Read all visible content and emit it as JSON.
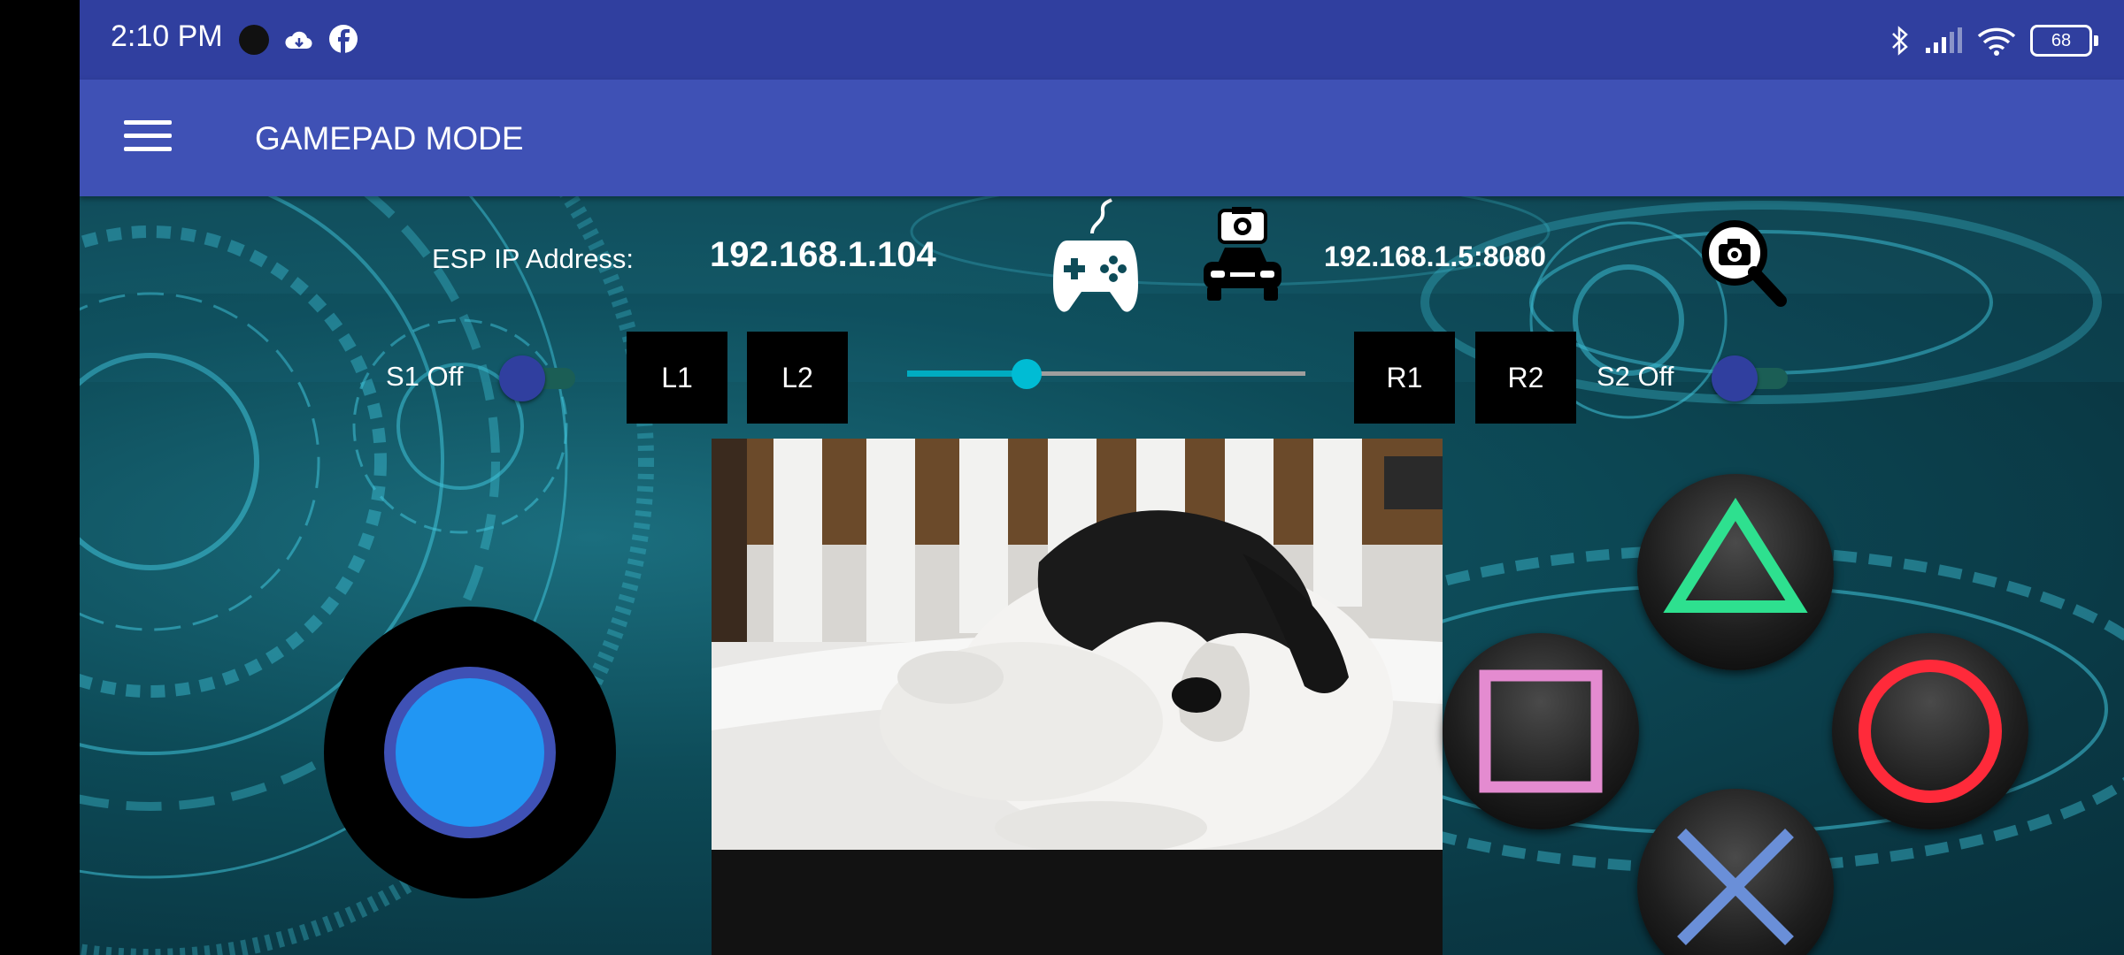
{
  "status_bar": {
    "time": "2:10 PM",
    "icons": [
      "dot-icon",
      "cloud-icon",
      "facebook-icon",
      "bluetooth-icon",
      "signal-icon",
      "wifi-icon"
    ],
    "battery": "68"
  },
  "toolbar": {
    "title": "GAMEPAD MODE",
    "menu_icon": "hamburger-icon"
  },
  "connection": {
    "esp_label": "ESP IP Address:",
    "esp_value": "192.168.1.104",
    "camera_address": "192.168.1.5:8080",
    "icons": [
      "gamepad-icon",
      "car-camera-icon",
      "camera-search-icon"
    ]
  },
  "controls": {
    "s1_label": "S1 Off",
    "s2_label": "S2 Off",
    "s1_on": false,
    "s2_on": false,
    "l1": "L1",
    "l2": "L2",
    "r1": "R1",
    "r2": "R2",
    "slider_value_fraction": 0.3
  },
  "face_buttons": [
    "triangle",
    "square",
    "circle",
    "cross"
  ],
  "colors": {
    "status_bar": "#303f9f",
    "toolbar": "#3f51b5",
    "accent": "#00bcd4",
    "joystick_stick": "#2196f3",
    "triangle": "#2ee08f",
    "square": "#e48bd0",
    "circle": "#ff2a3a",
    "cross": "#6a8fd8"
  }
}
